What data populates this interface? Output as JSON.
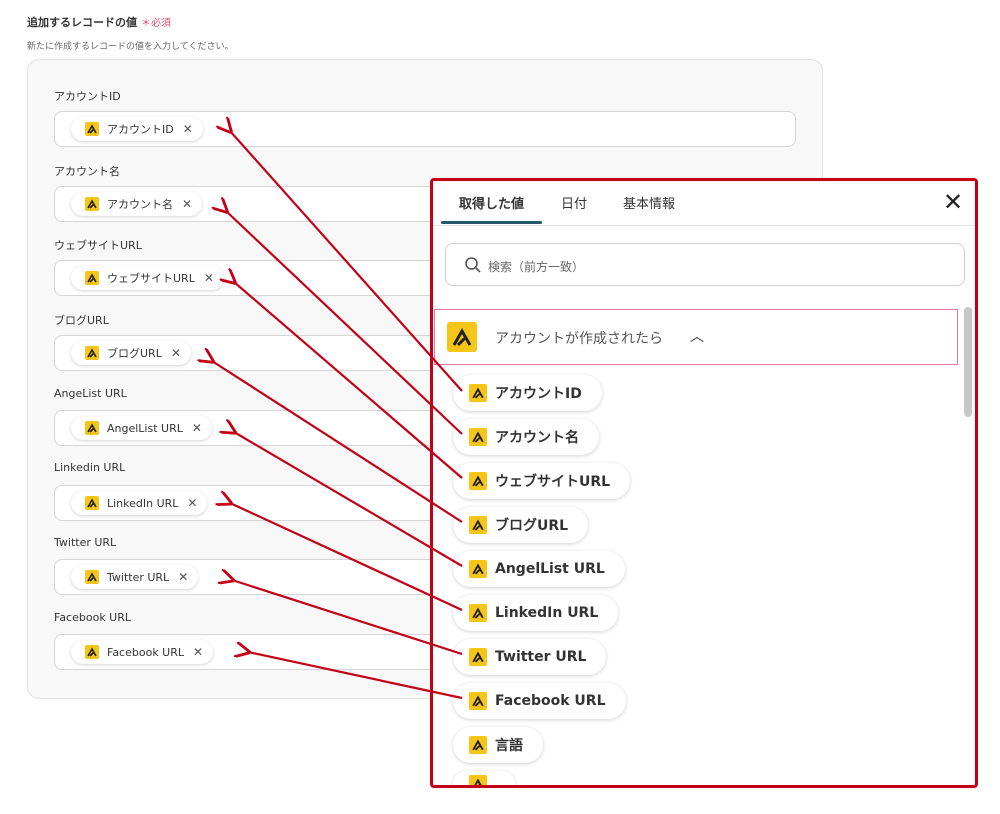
{
  "header": {
    "title": "追加するレコードの値",
    "required": "＊必須",
    "description": "新たに作成するレコードの値を入力してください。"
  },
  "fields": [
    {
      "label": "アカウントID",
      "chip": "アカウントID"
    },
    {
      "label": "アカウント名",
      "chip": "アカウント名"
    },
    {
      "label": "ウェブサイトURL",
      "chip": "ウェブサイトURL"
    },
    {
      "label": "ブログURL",
      "chip": "ブログURL"
    },
    {
      "label": "AngeList URL",
      "chip": "AngelList URL"
    },
    {
      "label": "Linkedin URL",
      "chip": "LinkedIn URL"
    },
    {
      "label": "Twitter URL",
      "chip": "Twitter URL"
    },
    {
      "label": "Facebook URL",
      "chip": "Facebook URL"
    }
  ],
  "popup": {
    "tabs": [
      "取得した値",
      "日付",
      "基本情報"
    ],
    "active_tab": "取得した値",
    "search_placeholder": "検索（前方一致）",
    "group_label": "アカウントが作成されたら",
    "items": [
      "アカウントID",
      "アカウント名",
      "ウェブサイトURL",
      "ブログURL",
      "AngelList URL",
      "LinkedIn URL",
      "Twitter URL",
      "Facebook URL",
      "言語"
    ]
  },
  "colors": {
    "accent_red": "#c40017",
    "logo_yellow": "#f5c518",
    "tab_underline": "#23596b",
    "group_border": "#e8779b"
  },
  "icons": {
    "close": "close-icon",
    "search": "search-icon",
    "chevron": "chevron-up-icon",
    "remove": "remove-icon",
    "app_logo": "app-logo-icon"
  }
}
